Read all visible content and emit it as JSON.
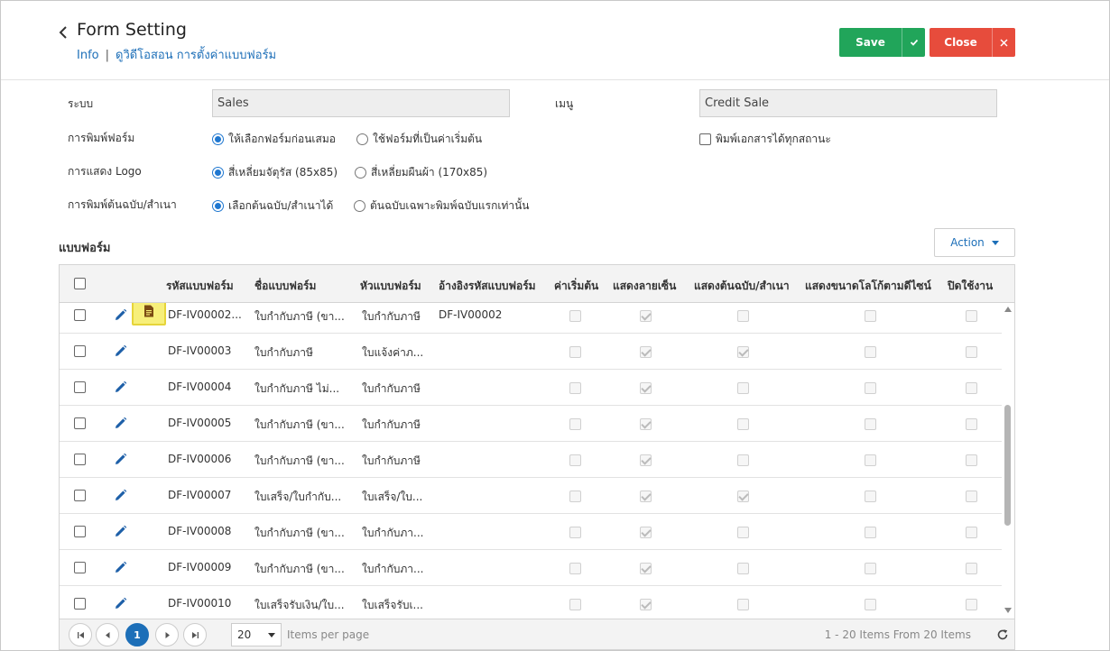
{
  "header": {
    "title": "Form Setting",
    "breadcrumb": {
      "info": "Info",
      "separator": "|",
      "current": "ดูวิดีโอสอน การตั้งค่าแบบฟอร์ม"
    },
    "save_label": "Save",
    "close_label": "Close"
  },
  "settings": {
    "system_label": "ระบบ",
    "system_value": "Sales",
    "menu_label": "เมนู",
    "menu_value": "Credit Sale",
    "print_form_label": "การพิมพ์ฟอร์ม",
    "print_form_opt1": "ให้เลือกฟอร์มก่อนเสมอ",
    "print_form_opt2": "ใช้ฟอร์มที่เป็นค่าเริ่มต้น",
    "print_all_status_label": "พิมพ์เอกสารได้ทุกสถานะ",
    "logo_label": "การแสดง Logo",
    "logo_opt1": "สี่เหลี่ยมจัตุรัส (85x85)",
    "logo_opt2": "สี่เหลี่ยมผืนผ้า (170x85)",
    "copy_label": "การพิมพ์ต้นฉบับ/สำเนา",
    "copy_opt1": "เลือกต้นฉบับ/สำเนาได้",
    "copy_opt2": "ต้นฉบับเฉพาะพิมพ์ฉบับแรกเท่านั้น"
  },
  "forms": {
    "section_title": "แบบฟอร์ม",
    "action_label": "Action",
    "columns": {
      "code": "รหัสแบบฟอร์ม",
      "name": "ชื่อแบบฟอร์ม",
      "heading": "หัวแบบฟอร์ม",
      "ref": "อ้างอิงรหัสแบบฟอร์ม",
      "default": "ค่าเริ่มต้น",
      "signature": "แสดงลายเซ็น",
      "copy": "แสดงต้นฉบับ/สำเนา",
      "logo_size": "แสดงขนาดโลโก้ตามดีไซน์",
      "disabled": "ปิดใช้งาน"
    },
    "rows": [
      {
        "code": "DF-IV00002...",
        "name": "ใบกำกับภาษี (ขา...",
        "heading": "ใบกำกับภาษี",
        "ref": "DF-IV00002",
        "default": false,
        "signature": true,
        "copy": false,
        "logo": false,
        "disabled": false
      },
      {
        "code": "DF-IV00003",
        "name": "ใบกำกับภาษี",
        "heading": "ใบแจ้งค่าภ...",
        "ref": "",
        "default": false,
        "signature": true,
        "copy": true,
        "logo": false,
        "disabled": false
      },
      {
        "code": "DF-IV00004",
        "name": "ใบกำกับภาษี ไม่...",
        "heading": "ใบกำกับภาษี",
        "ref": "",
        "default": false,
        "signature": true,
        "copy": false,
        "logo": false,
        "disabled": false
      },
      {
        "code": "DF-IV00005",
        "name": "ใบกำกับภาษี (ขา...",
        "heading": "ใบกำกับภาษี",
        "ref": "",
        "default": false,
        "signature": true,
        "copy": false,
        "logo": false,
        "disabled": false
      },
      {
        "code": "DF-IV00006",
        "name": "ใบกำกับภาษี (ขา...",
        "heading": "ใบกำกับภาษี",
        "ref": "",
        "default": false,
        "signature": true,
        "copy": false,
        "logo": false,
        "disabled": false
      },
      {
        "code": "DF-IV00007",
        "name": "ใบเสร็จ/ใบกำกับ...",
        "heading": "ใบเสร็จ/ใบ...",
        "ref": "",
        "default": false,
        "signature": true,
        "copy": true,
        "logo": false,
        "disabled": false
      },
      {
        "code": "DF-IV00008",
        "name": "ใบกำกับภาษี (ขา...",
        "heading": "ใบกำกับภา...",
        "ref": "",
        "default": false,
        "signature": true,
        "copy": false,
        "logo": false,
        "disabled": false
      },
      {
        "code": "DF-IV00009",
        "name": "ใบกำกับภาษี (ขา...",
        "heading": "ใบกำกับภา...",
        "ref": "",
        "default": false,
        "signature": true,
        "copy": false,
        "logo": false,
        "disabled": false
      },
      {
        "code": "DF-IV00010",
        "name": "ใบเสร็จรับเงิน/ใบ...",
        "heading": "ใบเสร็จรับเ...",
        "ref": "",
        "default": false,
        "signature": true,
        "copy": false,
        "logo": false,
        "disabled": false
      }
    ]
  },
  "pager": {
    "current_page": "1",
    "page_size": "20",
    "per_page_label": "Items per page",
    "info": "1 - 20 Items From 20 Items"
  },
  "colors": {
    "save": "#21a55a",
    "close": "#e74c3c",
    "link": "#1d6fb8",
    "highlight": "#f7ef7a"
  }
}
